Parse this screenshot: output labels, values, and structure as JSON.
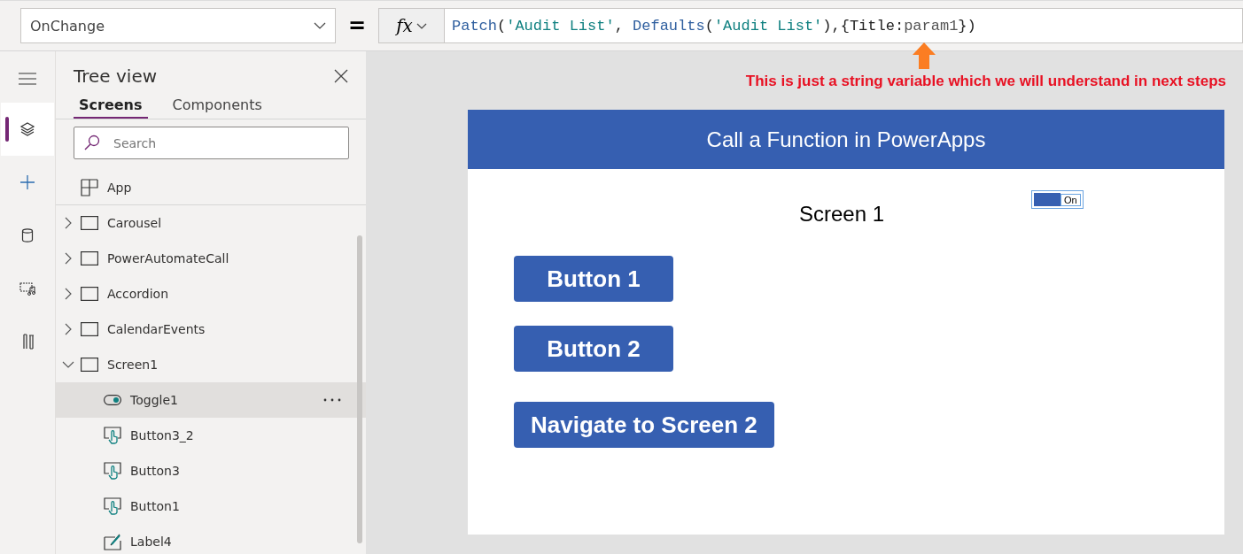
{
  "formula_bar": {
    "property": "OnChange",
    "equals": "=",
    "fx": "fx",
    "formula": [
      {
        "kind": "function",
        "text": "Patch"
      },
      {
        "kind": "plain",
        "text": "("
      },
      {
        "kind": "string",
        "text": "'Audit List'"
      },
      {
        "kind": "plain",
        "text": ", "
      },
      {
        "kind": "function",
        "text": "Defaults"
      },
      {
        "kind": "plain",
        "text": "("
      },
      {
        "kind": "string",
        "text": "'Audit List'"
      },
      {
        "kind": "plain",
        "text": "),{Title:"
      },
      {
        "kind": "muted",
        "text": "param1"
      },
      {
        "kind": "plain",
        "text": "})"
      }
    ]
  },
  "annotation": "This is just a string variable which we will understand in next steps",
  "rail": [
    {
      "kind": "layers",
      "selected": true
    },
    {
      "kind": "plus",
      "selected": false
    },
    {
      "kind": "data",
      "selected": false
    },
    {
      "kind": "media",
      "selected": false
    },
    {
      "kind": "tools",
      "selected": false
    }
  ],
  "tree_view": {
    "title": "Tree view",
    "tabs": [
      {
        "label": "Screens",
        "selected": true
      },
      {
        "label": "Components",
        "selected": false
      }
    ],
    "search": {
      "placeholder": "Search"
    },
    "items": [
      {
        "kind": "app",
        "label": "App"
      },
      {
        "kind": "screen",
        "label": "Carousel",
        "expanded": false,
        "selected": false
      },
      {
        "kind": "screen",
        "label": "PowerAutomateCall",
        "expanded": false,
        "selected": false
      },
      {
        "kind": "screen",
        "label": "Accordion",
        "expanded": false,
        "selected": false
      },
      {
        "kind": "screen",
        "label": "CalendarEvents",
        "expanded": false,
        "selected": false
      },
      {
        "kind": "screen",
        "label": "Screen1",
        "expanded": true,
        "selected": false,
        "children": [
          {
            "kind": "toggle",
            "label": "Toggle1",
            "selected": true
          },
          {
            "kind": "button",
            "label": "Button3_2",
            "selected": false
          },
          {
            "kind": "button",
            "label": "Button3",
            "selected": false
          },
          {
            "kind": "button",
            "label": "Button1",
            "selected": false
          },
          {
            "kind": "label",
            "label": "Label4",
            "selected": false
          }
        ]
      }
    ]
  },
  "canvas": {
    "header": "Call a Function in PowerApps",
    "screen_title": "Screen 1",
    "toggle": {
      "on": true,
      "label": "On",
      "selected": true
    },
    "buttons": [
      {
        "label": "Button 1"
      },
      {
        "label": "Button 2"
      },
      {
        "label": "Navigate to Screen 2"
      }
    ]
  }
}
